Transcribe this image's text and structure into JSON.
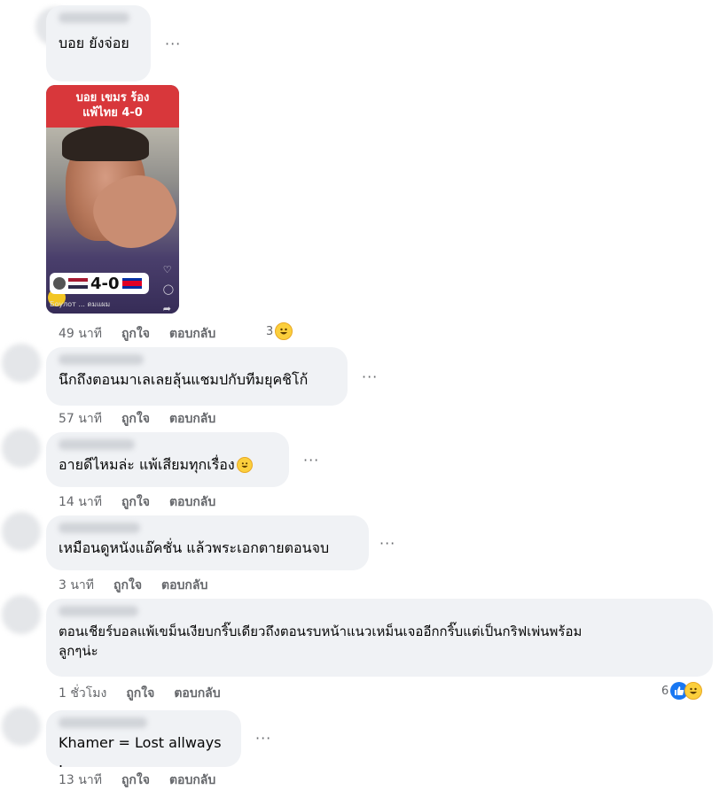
{
  "more_icon": "···",
  "video": {
    "title_line1": "บอย เขมร ร้อง",
    "title_line2": "แพ้ไทย 4-0",
    "score": "4-0",
    "caption": "Боулот ... ดมแผม"
  },
  "actions": {
    "like": "ถูกใจ",
    "reply": "ตอบกลับ"
  },
  "comments": [
    {
      "text": "บอย ยังจ่อย",
      "time": "49 นาที",
      "reactions": "3",
      "reaction_icons": [
        "haha"
      ]
    },
    {
      "text": "นึกถึงตอนมาเลเลยลุ้นแชมปกับทีมยุคชิโก้",
      "time": "57 นาที"
    },
    {
      "text": "อายดีไหมล่ะ แพ้เสียมทุกเรื่อง",
      "time": "14 นาที",
      "inline_emoji": "haha"
    },
    {
      "text": "เหมือนดูหนังแอ๊คชั่น แล้วพระเอกตายตอนจบ",
      "time": "3 นาที"
    },
    {
      "text_line1": "ตอนเชียร์บอลแพ้เขม็นเงียบกริ๊บเดียวถึงตอนรบหน้าแนวเหม็นเจออีกกริ๊บแต่เป็นกริฟเพ่นพร้อม",
      "text_line2": "ลูกๆน่ะ",
      "time": "1 ชั่วโมง",
      "reactions": "6",
      "reaction_icons": [
        "like",
        "haha"
      ]
    },
    {
      "text": "Khamer = Lost allways .",
      "time": "13 นาที"
    }
  ],
  "colors": {
    "bubble": "#f0f2f5",
    "meta": "#65676b",
    "video_header": "#d8373b",
    "like_blue": "#1877f2",
    "haha_yellow": "#fbcf3c"
  }
}
